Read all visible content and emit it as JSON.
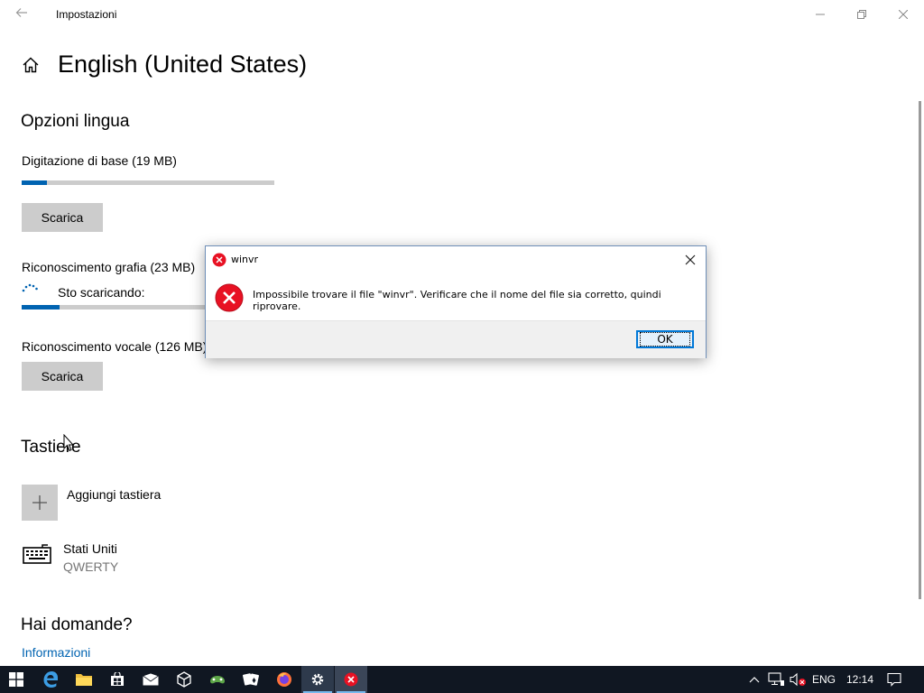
{
  "window": {
    "title": "Impostazioni",
    "page_title": "English (United States)"
  },
  "language_options": {
    "heading": "Opzioni lingua",
    "basic_typing": {
      "label": "Digitazione di base (19 MB)",
      "progress": 0.1,
      "button": "Scarica"
    },
    "handwriting": {
      "label": "Riconoscimento grafia (23 MB)",
      "status": "Sto scaricando:",
      "progress": 0.15
    },
    "speech": {
      "label": "Riconoscimento vocale (126 MB)",
      "button": "Scarica"
    }
  },
  "keyboards": {
    "heading": "Tastiere",
    "add_label": "Aggiungi tastiera",
    "items": [
      {
        "name": "Stati Uniti",
        "layout": "QWERTY"
      }
    ]
  },
  "help": {
    "heading": "Hai domande?",
    "link": "Informazioni"
  },
  "dialog": {
    "title": "winvr",
    "message": "Impossibile trovare il file \"winvr\". Verificare che il nome del file sia corretto, quindi riprovare.",
    "ok_label": "OK",
    "icon": "error-icon"
  },
  "taskbar": {
    "apps": [
      "start-icon",
      "edge-icon",
      "file-explorer-icon",
      "store-icon",
      "mail-icon",
      "3d-viewer-icon",
      "xbox-icon",
      "solitaire-icon",
      "firefox-icon",
      "settings-icon",
      "error-app-icon"
    ],
    "language": "ENG",
    "time": "12:14"
  },
  "colors": {
    "accent": "#0063b1",
    "taskbar": "#101722",
    "error_red": "#e81123"
  }
}
